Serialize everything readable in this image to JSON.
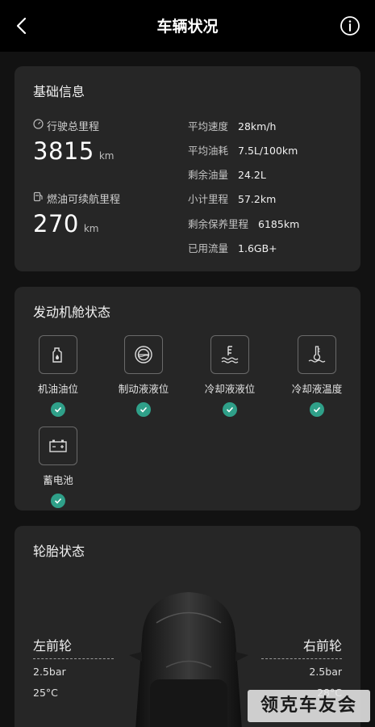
{
  "header": {
    "title": "车辆状况",
    "back_icon": "chevron-left-icon",
    "info_icon": "info-circle-icon"
  },
  "basic": {
    "title": "基础信息",
    "odometer": {
      "label": "行驶总里程",
      "value": "3815",
      "unit": "km",
      "icon": "odometer-icon"
    },
    "range": {
      "label": "燃油可续航里程",
      "value": "270",
      "unit": "km",
      "icon": "fuel-pump-icon"
    },
    "stats": [
      {
        "label": "平均速度",
        "value": "28km/h"
      },
      {
        "label": "平均油耗",
        "value": "7.5L/100km"
      },
      {
        "label": "剩余油量",
        "value": "24.2L"
      },
      {
        "label": "小计里程",
        "value": "57.2km"
      },
      {
        "label": "剩余保养里程",
        "value": "6185km"
      },
      {
        "label": "已用流量",
        "value": "1.6GB+"
      }
    ]
  },
  "engine": {
    "title": "发动机舱状态",
    "items": [
      {
        "label": "机油油位",
        "icon": "oil-bottle-icon",
        "status": "ok"
      },
      {
        "label": "制动液液位",
        "icon": "brake-fluid-icon",
        "status": "ok"
      },
      {
        "label": "冷却液液位",
        "icon": "coolant-level-icon",
        "status": "ok"
      },
      {
        "label": "冷却液温度",
        "icon": "coolant-temp-icon",
        "status": "ok"
      },
      {
        "label": "蓄电池",
        "icon": "battery-icon",
        "status": "ok"
      }
    ],
    "ok_color": "#2fa089"
  },
  "tire": {
    "title": "轮胎状态",
    "front_left": {
      "name": "左前轮",
      "pressure": "2.5bar",
      "temp": "25°C"
    },
    "front_right": {
      "name": "右前轮",
      "pressure": "2.5bar",
      "temp": "28°C"
    }
  },
  "watermark": "领克车友会"
}
